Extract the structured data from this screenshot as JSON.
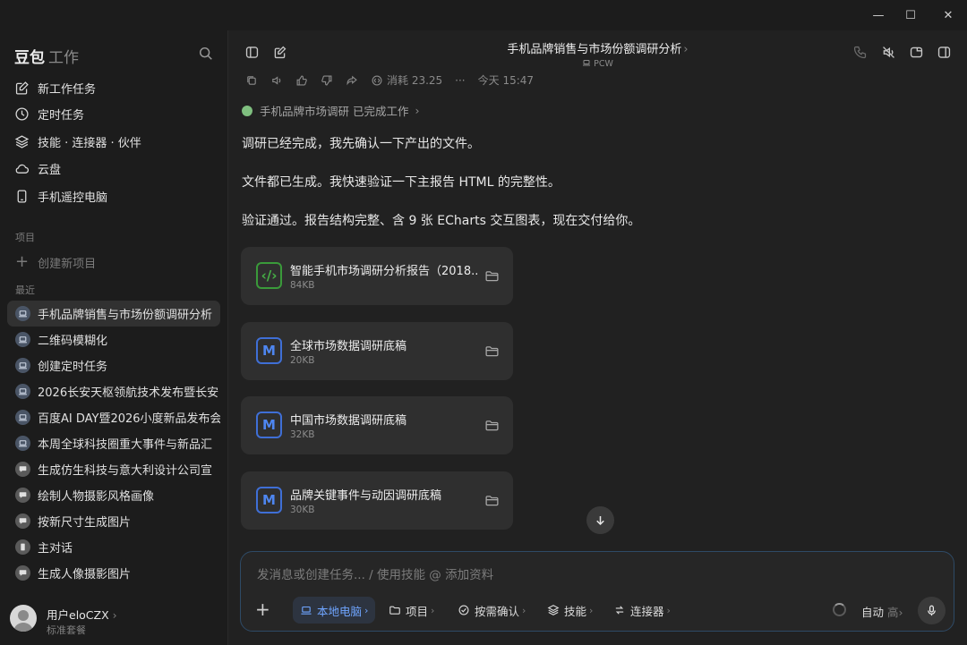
{
  "window": {
    "controls": {
      "minimize": "—",
      "maximize": "☐",
      "close": "✕"
    }
  },
  "sidebar": {
    "brand": "豆包",
    "brand_sub": "工作",
    "nav": [
      {
        "label": "新工作任务",
        "icon": "edit-icon"
      },
      {
        "label": "定时任务",
        "icon": "clock-icon"
      },
      {
        "label": "技能 · 连接器 · 伙伴",
        "icon": "layers-icon"
      },
      {
        "label": "云盘",
        "icon": "cloud-icon"
      },
      {
        "label": "手机遥控电脑",
        "icon": "phone-icon"
      }
    ],
    "projects_label": "项目",
    "new_project": "创建新项目",
    "recent_label": "最近",
    "recent": [
      {
        "label": "手机品牌销售与市场份额调研分析",
        "active": true,
        "icon": "laptop-icon"
      },
      {
        "label": "二维码模糊化",
        "icon": "laptop-icon"
      },
      {
        "label": "创建定时任务",
        "icon": "laptop-icon"
      },
      {
        "label": "2026长安天枢领航技术发布暨长安",
        "icon": "laptop-icon"
      },
      {
        "label": "百度AI DAY暨2026小度新品发布会",
        "icon": "laptop-icon"
      },
      {
        "label": "本周全球科技圈重大事件与新品汇",
        "icon": "laptop-icon"
      },
      {
        "label": "生成仿生科技与意大利设计公司宣",
        "icon": "chat-icon"
      },
      {
        "label": "绘制人物摄影风格画像",
        "icon": "chat-icon"
      },
      {
        "label": "按新尺寸生成图片",
        "icon": "chat-icon"
      },
      {
        "label": "主对话",
        "icon": "doc-icon"
      },
      {
        "label": "生成人像摄影图片",
        "icon": "chat-icon"
      }
    ],
    "user": {
      "name": "用户eloCZX",
      "chevron": "›",
      "plan": "标准套餐"
    }
  },
  "header": {
    "title": "手机品牌销售与市场份额调研分析",
    "title_chevron": "›",
    "subtitle": "PCW"
  },
  "message": {
    "actions": {
      "usage": "消耗 23.25",
      "more": "···",
      "time": "今天 15:47"
    },
    "task_line": "手机品牌市场调研 已完成工作",
    "task_chevron": "›",
    "paragraphs": [
      "调研已经完成，我先确认一下产出的文件。",
      "文件都已生成。我快速验证一下主报告 HTML 的完整性。",
      "验证通过。报告结构完整、含 9 张 ECharts 交互图表，现在交付给你。"
    ],
    "files": [
      {
        "name": "智能手机市场调研分析报告（2018...",
        "size": "84KB",
        "type": "code"
      },
      {
        "name": "全球市场数据调研底稿",
        "size": "20KB",
        "type": "md"
      },
      {
        "name": "中国市场数据调研底稿",
        "size": "32KB",
        "type": "md"
      },
      {
        "name": "品牌关键事件与动因调研底稿",
        "size": "30KB",
        "type": "md"
      }
    ]
  },
  "composer": {
    "placeholder": "发消息或创建任务... / 使用技能 @ 添加资料",
    "chips": {
      "local": "本地电脑",
      "project": "项目",
      "confirm": "按需确认",
      "skills": "技能",
      "connectors": "连接器"
    },
    "chip_chevron": "›",
    "mode": "自动",
    "mode_level": "高"
  },
  "colors": {
    "accent": "#6fa5ff",
    "code_file": "#46b046",
    "md_file": "#4e86f0"
  }
}
